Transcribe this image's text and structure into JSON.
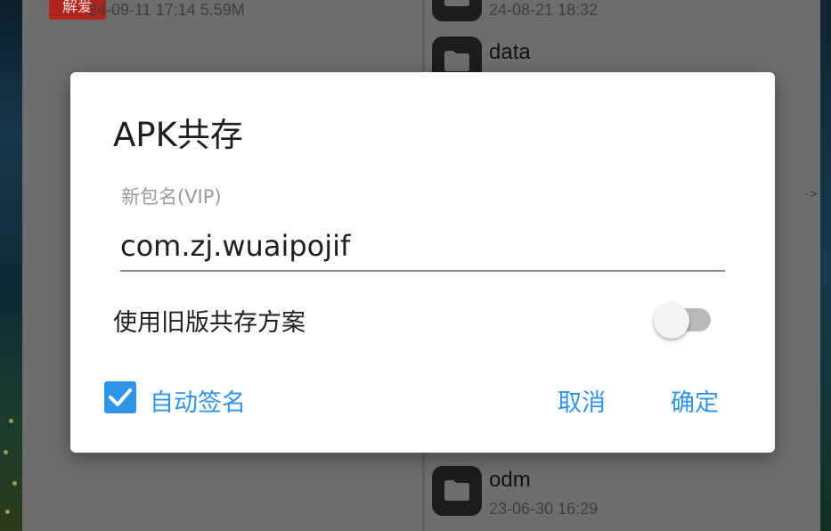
{
  "background": {
    "left_panel": {
      "thumb_text": "解爱",
      "file_meta": "24-09-11 17:14  5.59M"
    },
    "right_panel": {
      "items": [
        {
          "name": "",
          "date": "24-08-21 18:32"
        },
        {
          "name": "data",
          "date": ""
        },
        {
          "name": "odm",
          "date": "23-06-30 16:29"
        }
      ],
      "arrow_hint": "->"
    }
  },
  "dialog": {
    "title": "APK共存",
    "field_label": "新包名(VIP)",
    "field_value": "com.zj.wuaipojif",
    "legacy_switch_label": "使用旧版共存方案",
    "legacy_switch_on": false,
    "auto_sign_label": "自动签名",
    "auto_sign_checked": true,
    "cancel_label": "取消",
    "ok_label": "确定"
  },
  "colors": {
    "accent": "#2f95e8",
    "overlay": "#6d6d6d",
    "dialog_bg": "#ffffff"
  },
  "icons": [
    "folder-icon",
    "check-icon"
  ]
}
